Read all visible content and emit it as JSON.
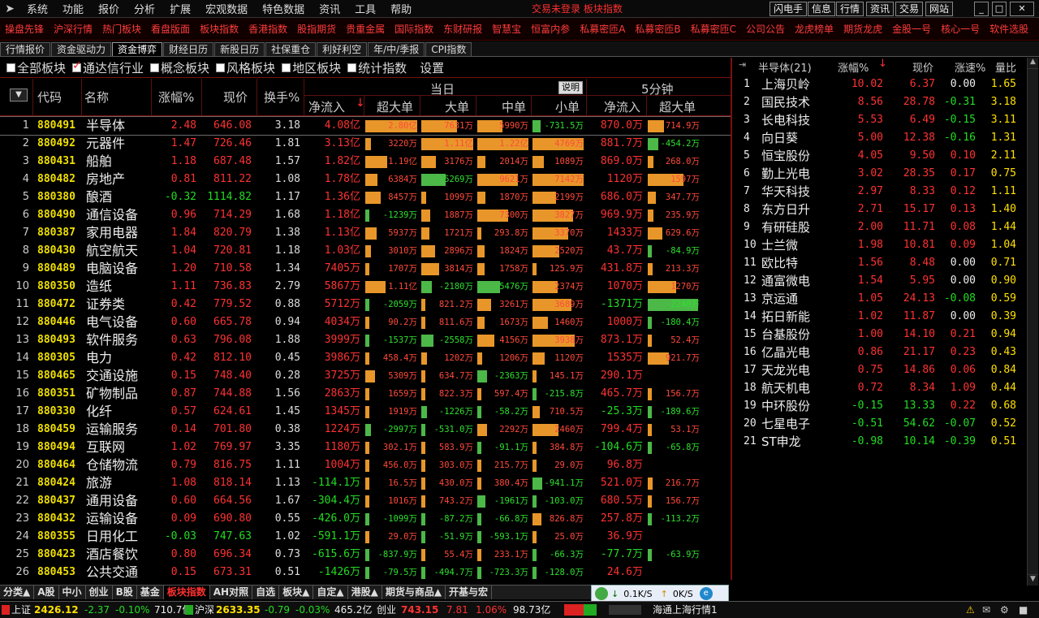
{
  "menu": {
    "items": [
      "系统",
      "功能",
      "报价",
      "分析",
      "扩展",
      "宏观数据",
      "特色数据",
      "资讯",
      "工具",
      "帮助"
    ],
    "notice": "交易未登录  板块指数",
    "right": [
      "闪电手",
      "信息",
      "行情",
      "资讯",
      "交易",
      "网站"
    ]
  },
  "redbar": [
    "操盘先锋",
    "沪深行情",
    "热门板块",
    "看盘版面",
    "板块指数",
    "香港指数",
    "股指期货",
    "贵重金属",
    "国际指数",
    "东财研报",
    "智慧宝",
    "恒富内参",
    "私募密匝A",
    "私募密匝B",
    "私募密匝C",
    "公司公告",
    "龙虎榜单",
    "期货龙虎",
    "金股一号",
    "核心一号",
    "软件选股"
  ],
  "functabs": [
    "行情报价",
    "资金驱动力",
    "资金博弈",
    "财经日历",
    "新股日历",
    "社保重仓",
    "利好利空",
    "年/中/季报",
    "CPI指数"
  ],
  "filters": [
    {
      "label": "全部板块",
      "checked": false
    },
    {
      "label": "通达信行业",
      "checked": true
    },
    {
      "label": "概念板块",
      "checked": false
    },
    {
      "label": "风格板块",
      "checked": false
    },
    {
      "label": "地区板块",
      "checked": false
    },
    {
      "label": "统计指数",
      "checked": false
    }
  ],
  "settings_label": "设置",
  "header": {
    "code": "代码",
    "name": "名称",
    "pct": "涨幅%",
    "price": "现价",
    "turnover": "换手%",
    "today": "当日",
    "explain": "说明",
    "five": "5分钟",
    "net": "净流入",
    "xl": "超大单",
    "l": "大单",
    "m": "中单",
    "s": "小单",
    "net5": "净流入",
    "xl5": "超大单"
  },
  "rows": [
    [
      "1",
      "880491",
      "半导体",
      "2.48",
      "646.08",
      "3.18",
      "4.08亿",
      "2.80亿",
      "7631万",
      "5990万",
      "-731.5万",
      "870.0万",
      "714.9万"
    ],
    [
      "2",
      "880492",
      "元器件",
      "1.47",
      "726.46",
      "1.81",
      "3.13亿",
      "3220万",
      "1.11亿",
      "1.22亿",
      "4769万",
      "881.7万",
      "-454.2万"
    ],
    [
      "3",
      "880431",
      "船舶",
      "1.18",
      "687.48",
      "1.57",
      "1.82亿",
      "1.19亿",
      "3176万",
      "2014万",
      "1089万",
      "869.0万",
      "268.0万"
    ],
    [
      "4",
      "880482",
      "房地产",
      "0.81",
      "811.22",
      "1.08",
      "1.78亿",
      "6384万",
      "-5269万",
      "9621万",
      "7142万",
      "1120万",
      "1597万"
    ],
    [
      "5",
      "880380",
      "酿酒",
      "-0.32",
      "1114.82",
      "1.17",
      "1.36亿",
      "8457万",
      "1099万",
      "1870万",
      "2199万",
      "686.0万",
      "347.7万"
    ],
    [
      "6",
      "880490",
      "通信设备",
      "0.96",
      "714.29",
      "1.68",
      "1.18亿",
      "-1239万",
      "1887万",
      "7300万",
      "3827万",
      "969.9万",
      "235.9万"
    ],
    [
      "7",
      "880387",
      "家用电器",
      "1.84",
      "820.79",
      "1.38",
      "1.13亿",
      "5937万",
      "1721万",
      "293.8万",
      "3370万",
      "1433万",
      "629.6万"
    ],
    [
      "8",
      "880430",
      "航空航天",
      "1.04",
      "720.81",
      "1.18",
      "1.03亿",
      "3010万",
      "2896万",
      "1824万",
      "2520万",
      "43.7万",
      "-84.9万"
    ],
    [
      "9",
      "880489",
      "电脑设备",
      "1.20",
      "710.58",
      "1.34",
      "7405万",
      "1707万",
      "3814万",
      "1758万",
      "125.9万",
      "431.8万",
      "213.3万"
    ],
    [
      "10",
      "880350",
      "造纸",
      "1.11",
      "736.83",
      "2.79",
      "5867万",
      "1.11亿",
      "-2180万",
      "-5476万",
      "2374万",
      "1070万",
      "1270万"
    ],
    [
      "11",
      "880472",
      "证券类",
      "0.42",
      "779.52",
      "0.88",
      "5712万",
      "-2059万",
      "821.2万",
      "3261万",
      "3689万",
      "-1371万",
      "-2240万"
    ],
    [
      "12",
      "880446",
      "电气设备",
      "0.60",
      "665.78",
      "0.94",
      "4034万",
      "90.2万",
      "811.6万",
      "1673万",
      "1460万",
      "1000万",
      "-180.4万"
    ],
    [
      "13",
      "880493",
      "软件服务",
      "0.63",
      "796.08",
      "1.88",
      "3999万",
      "-1537万",
      "-2558万",
      "4156万",
      "3938万",
      "873.1万",
      "52.4万"
    ],
    [
      "14",
      "880305",
      "电力",
      "0.42",
      "812.10",
      "0.45",
      "3986万",
      "458.4万",
      "1202万",
      "1206万",
      "1120万",
      "1535万",
      "921.7万"
    ],
    [
      "15",
      "880465",
      "交通设施",
      "0.15",
      "748.40",
      "0.28",
      "3725万",
      "5309万",
      "634.7万",
      "-2363万",
      "145.1万",
      "290.1万",
      ""
    ],
    [
      "16",
      "880351",
      "矿物制品",
      "0.87",
      "744.88",
      "1.56",
      "2863万",
      "1659万",
      "822.3万",
      "597.4万",
      "-215.8万",
      "465.7万",
      "156.7万"
    ],
    [
      "17",
      "880330",
      "化纤",
      "0.57",
      "624.61",
      "1.45",
      "1345万",
      "1919万",
      "-1226万",
      "-58.2万",
      "710.5万",
      "-25.3万",
      "-189.6万"
    ],
    [
      "18",
      "880459",
      "运输服务",
      "0.14",
      "701.80",
      "0.38",
      "1224万",
      "-2997万",
      "-531.0万",
      "2292万",
      "2460万",
      "799.4万",
      "53.1万"
    ],
    [
      "19",
      "880494",
      "互联网",
      "1.02",
      "769.97",
      "3.35",
      "1180万",
      "302.1万",
      "583.9万",
      "-91.1万",
      "384.8万",
      "-104.6万",
      "-65.8万"
    ],
    [
      "20",
      "880464",
      "仓储物流",
      "0.79",
      "816.75",
      "1.11",
      "1004万",
      "456.0万",
      "303.0万",
      "215.7万",
      "29.0万",
      "96.8万",
      ""
    ],
    [
      "21",
      "880424",
      "旅游",
      "1.08",
      "818.14",
      "1.13",
      "-114.1万",
      "16.5万",
      "430.0万",
      "380.4万",
      "-941.1万",
      "521.0万",
      "216.7万"
    ],
    [
      "22",
      "880437",
      "通用设备",
      "0.60",
      "664.56",
      "1.67",
      "-304.4万",
      "1016万",
      "743.2万",
      "-1961万",
      "-103.0万",
      "680.5万",
      "156.7万"
    ],
    [
      "23",
      "880432",
      "运输设备",
      "0.09",
      "690.80",
      "0.55",
      "-426.0万",
      "-1099万",
      "-87.2万",
      "-66.8万",
      "826.8万",
      "257.8万",
      "-113.2万"
    ],
    [
      "24",
      "880355",
      "日用化工",
      "-0.03",
      "747.63",
      "1.02",
      "-591.1万",
      "29.0万",
      "-51.9万",
      "-593.1万",
      "25.0万",
      "36.9万",
      ""
    ],
    [
      "25",
      "880423",
      "酒店餐饮",
      "0.80",
      "696.34",
      "0.73",
      "-615.6万",
      "-837.9万",
      "55.4万",
      "233.1万",
      "-66.3万",
      "-77.7万",
      "-63.9万"
    ],
    [
      "26",
      "880453",
      "公共交通",
      "0.15",
      "673.31",
      "0.51",
      "-1426万",
      "-79.5万",
      "-494.7万",
      "-723.3万",
      "-128.0万",
      "24.6万",
      ""
    ]
  ],
  "right": {
    "title": "半导体(21)",
    "pct": "涨幅%",
    "price": "现价",
    "speed": "涨速%",
    "vr": "量比",
    "rows": [
      [
        "1",
        "上海贝岭",
        "10.02",
        "6.37",
        "0.00",
        "1.65"
      ],
      [
        "2",
        "国民技术",
        "8.56",
        "28.78",
        "-0.31",
        "3.18"
      ],
      [
        "3",
        "长电科技",
        "5.53",
        "6.49",
        "-0.15",
        "3.11"
      ],
      [
        "4",
        "向日葵",
        "5.00",
        "12.38",
        "-0.16",
        "1.31"
      ],
      [
        "5",
        "恒宝股份",
        "4.05",
        "9.50",
        "0.10",
        "2.11"
      ],
      [
        "6",
        "勤上光电",
        "3.02",
        "28.35",
        "0.17",
        "0.75"
      ],
      [
        "7",
        "华天科技",
        "2.97",
        "8.33",
        "0.12",
        "1.11"
      ],
      [
        "8",
        "东方日升",
        "2.71",
        "15.17",
        "0.13",
        "1.40"
      ],
      [
        "9",
        "有研硅股",
        "2.00",
        "11.71",
        "0.08",
        "1.44"
      ],
      [
        "10",
        "士兰微",
        "1.98",
        "10.81",
        "0.09",
        "1.04"
      ],
      [
        "11",
        "欧比特",
        "1.56",
        "8.48",
        "0.00",
        "0.71"
      ],
      [
        "12",
        "通富微电",
        "1.54",
        "5.95",
        "0.00",
        "0.90"
      ],
      [
        "13",
        "京运通",
        "1.05",
        "24.13",
        "-0.08",
        "0.59"
      ],
      [
        "14",
        "拓日新能",
        "1.02",
        "11.87",
        "0.00",
        "0.39"
      ],
      [
        "15",
        "台基股份",
        "1.00",
        "14.10",
        "0.21",
        "0.94"
      ],
      [
        "16",
        "亿晶光电",
        "0.86",
        "21.17",
        "0.23",
        "0.43"
      ],
      [
        "17",
        "天龙光电",
        "0.75",
        "14.86",
        "0.06",
        "0.84"
      ],
      [
        "18",
        "航天机电",
        "0.72",
        "8.34",
        "1.09",
        "0.44"
      ],
      [
        "19",
        "中环股份",
        "-0.15",
        "13.33",
        "0.22",
        "0.68"
      ],
      [
        "20",
        "七星电子",
        "-0.51",
        "54.62",
        "-0.07",
        "0.52"
      ],
      [
        "21",
        "ST申龙",
        "-0.98",
        "10.14",
        "-0.39",
        "0.51"
      ]
    ]
  },
  "btabs": [
    "分类▲",
    "A股",
    "中小",
    "创业",
    "B股",
    "基金",
    "板块指数",
    "AH对照",
    "自选",
    "板块▲",
    "自定▲",
    "港股▲",
    "期货与商品▲",
    "开基与宏"
  ],
  "speed": {
    "down": "0.1K/S",
    "up": "0K/S"
  },
  "status": {
    "sh_label": "上证",
    "sh_idx": "2426.12",
    "sh_chg": "-2.37",
    "sh_pct": "-0.10%",
    "sh_amt": "710.7亿",
    "hs_label": "沪深",
    "hs_idx": "2633.35",
    "hs_chg": "-0.79",
    "hs_pct": "-0.03%",
    "hs_amt": "465.2亿",
    "cy_label": "创业",
    "cy_idx": "743.15",
    "cy_chg": "7.81",
    "cy_pct": "1.06%",
    "cy_amt": "98.73亿",
    "conn": "海通上海行情1"
  },
  "colors": {
    "up": "#ff3232",
    "down": "#22dd22",
    "code": "#f0e000",
    "bar_pos": "#e8962a",
    "bar_neg": "#4cb848"
  }
}
